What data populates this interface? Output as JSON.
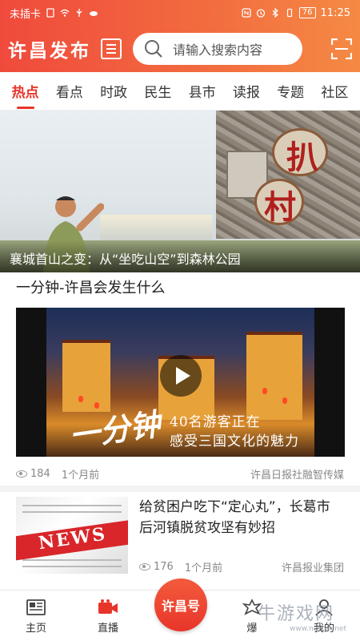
{
  "status_bar": {
    "carrier": "未插卡",
    "battery": "76",
    "time": "11:25"
  },
  "header": {
    "app_title": "许昌发布",
    "search_placeholder": "请输入搜索内容"
  },
  "tabs": [
    {
      "label": "热点",
      "active": true
    },
    {
      "label": "看点",
      "active": false
    },
    {
      "label": "时政",
      "active": false
    },
    {
      "label": "民生",
      "active": false
    },
    {
      "label": "县市",
      "active": false
    },
    {
      "label": "读报",
      "active": false
    },
    {
      "label": "专题",
      "active": false
    },
    {
      "label": "社区",
      "active": false
    }
  ],
  "hero": {
    "caption": "襄城首山之变：从“坐吃山空”到森林公园",
    "sign_text": "扒村"
  },
  "video_post": {
    "title": "一分钟-许昌会发生什么",
    "overlay_brush": "一分钟",
    "overlay_line1": "40名游客正在",
    "overlay_line2": "感受三国文化的魅力",
    "views": "184",
    "time_ago": "1个月前",
    "source": "许昌日报社融智传媒"
  },
  "news_item": {
    "title": "给贫困户吃下“定心丸”，长葛市后河镇脱贫攻坚有妙招",
    "thumb_text": "NEWS",
    "views": "176",
    "time_ago": "1个月前",
    "source": "许昌报业集团"
  },
  "bottom_nav": {
    "home": "主页",
    "live": "直播",
    "center": "许昌号",
    "explode": "爆",
    "mine": "我的"
  },
  "watermark": {
    "text": "牛游戏网",
    "url": "www.newyx.net"
  },
  "colors": {
    "accent": "#e8352a",
    "header_gradient_start": "#f04a3c",
    "header_gradient_end": "#f58a44"
  }
}
